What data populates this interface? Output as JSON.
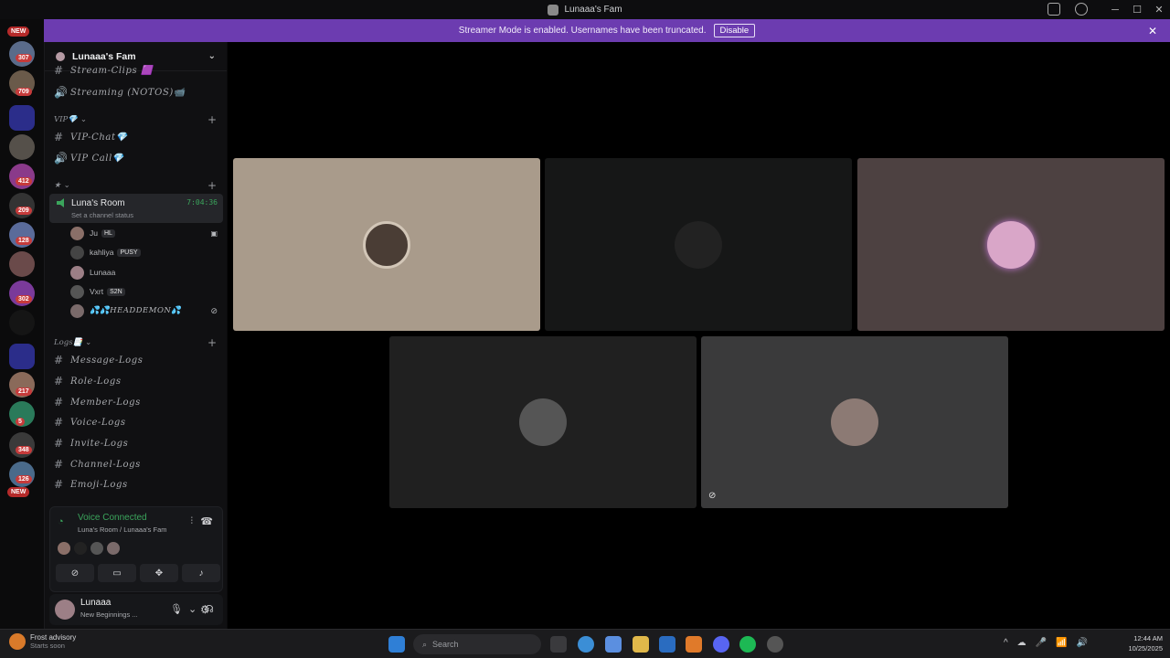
{
  "window": {
    "title": "Lunaaa's Fam"
  },
  "banner": {
    "text": "Streamer Mode is enabled. Usernames have been truncated.",
    "disable_label": "Disable"
  },
  "rail": {
    "badges": [
      "NEW",
      "307",
      "709",
      "412",
      "209",
      "128",
      "302",
      "217",
      "5",
      "348",
      "126",
      "NEW"
    ]
  },
  "server": {
    "name": "Lunaaa's Fam"
  },
  "channels": {
    "top": [
      {
        "name": "Stream-Clips 🟪",
        "type": "text"
      },
      {
        "name": "Streaming (NOTOS)📹",
        "type": "voice"
      }
    ],
    "vip_category": "VIP💎",
    "vip": [
      {
        "name": "VIP-Chat💎",
        "type": "text"
      },
      {
        "name": "VIP Call💎",
        "type": "voice"
      }
    ],
    "star_category": "★",
    "voice_room": {
      "name": "Luna's Room",
      "timer": "7:04:36",
      "status": "Set a channel status"
    },
    "voice_users": [
      {
        "name": "Ju",
        "tag": "HL",
        "color": "#8a6f68"
      },
      {
        "name": "kahliya",
        "tag": "PUSY",
        "color": "#444"
      },
      {
        "name": "Lunaaa",
        "tag": "",
        "color": "#9c7f86"
      },
      {
        "name": "Vxrt",
        "tag": "S2N",
        "color": "#555"
      },
      {
        "name": "💦💦HEADDEMON💦",
        "tag": "",
        "color": "#7a6a6a"
      }
    ],
    "logs_category": "Logs📑",
    "logs": [
      "Message-Logs",
      "Role-Logs",
      "Member-Logs",
      "Voice-Logs",
      "Invite-Logs",
      "Channel-Logs",
      "Emoji-Logs"
    ]
  },
  "voice_panel": {
    "title": "Voice Connected",
    "subtitle": "Luna's Room / Lunaaa's Fam"
  },
  "user": {
    "name": "Lunaaa",
    "status": "New Beginnings ..."
  },
  "tiles": [
    {
      "bg": "#a99b8b",
      "avatar": "#4a3d35"
    },
    {
      "bg": "#161717",
      "avatar": "#222"
    },
    {
      "bg": "#4d4141",
      "avatar": "#d9a6c8"
    },
    {
      "bg": "#202020",
      "avatar": "#555"
    },
    {
      "bg": "#3a3a3b",
      "avatar": "#8c7a74"
    }
  ],
  "taskbar": {
    "weather_title": "Frost advisory",
    "weather_sub": "Starts soon",
    "search_placeholder": "Search",
    "time": "12:44 AM",
    "date": "10/25/2025"
  }
}
